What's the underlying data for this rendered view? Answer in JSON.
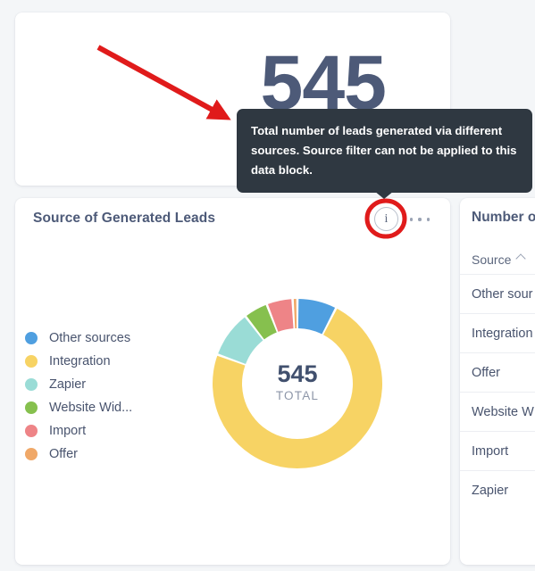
{
  "kpi": {
    "value": "545"
  },
  "tooltip": {
    "text": "Total number of leads generated via different sources. Source filter can not be applied to this data block."
  },
  "donut_card": {
    "title": "Source of Generated Leads",
    "info_icon_label": "i",
    "info_icon_name": "info-icon",
    "kebab_icon_name": "more-options-icon",
    "center_value": "545",
    "center_label": "TOTAL"
  },
  "table_card": {
    "title": "Number o",
    "column_header": "Source",
    "sort_direction": "asc",
    "rows": [
      {
        "source": "Other sour"
      },
      {
        "source": "Integration"
      },
      {
        "source": "Offer"
      },
      {
        "source": "Website W"
      },
      {
        "source": "Import"
      },
      {
        "source": "Zapier"
      }
    ]
  },
  "annotations": {
    "arrow_color": "#e01b1b",
    "circle_color": "#e01b1b"
  },
  "colors": {
    "accent_text": "#4d5a78",
    "tooltip_bg": "#2f3841",
    "page_bg": "#f4f6f8"
  },
  "chart_data": {
    "type": "pie",
    "title": "Source of Generated Leads",
    "center_value": 545,
    "center_label": "TOTAL",
    "total": 545,
    "legend_position": "left",
    "donut": true,
    "categories": [
      "Other sources",
      "Integration",
      "Zapier",
      "Website Wid...",
      "Import",
      "Offer"
    ],
    "values": [
      41,
      398,
      49,
      25,
      27,
      5
    ],
    "percentages": [
      7.5,
      73.0,
      9.0,
      4.6,
      5.0,
      0.9
    ],
    "colors": [
      "#4f9fe0",
      "#f7d364",
      "#9adcd6",
      "#86c04e",
      "#ee8487",
      "#f0a868"
    ],
    "legend": [
      {
        "label": "Other sources",
        "color": "#4f9fe0"
      },
      {
        "label": "Integration",
        "color": "#f7d364"
      },
      {
        "label": "Zapier",
        "color": "#9adcd6"
      },
      {
        "label": "Website Wid...",
        "color": "#86c04e"
      },
      {
        "label": "Import",
        "color": "#ee8487"
      },
      {
        "label": "Offer",
        "color": "#f0a868"
      }
    ]
  }
}
